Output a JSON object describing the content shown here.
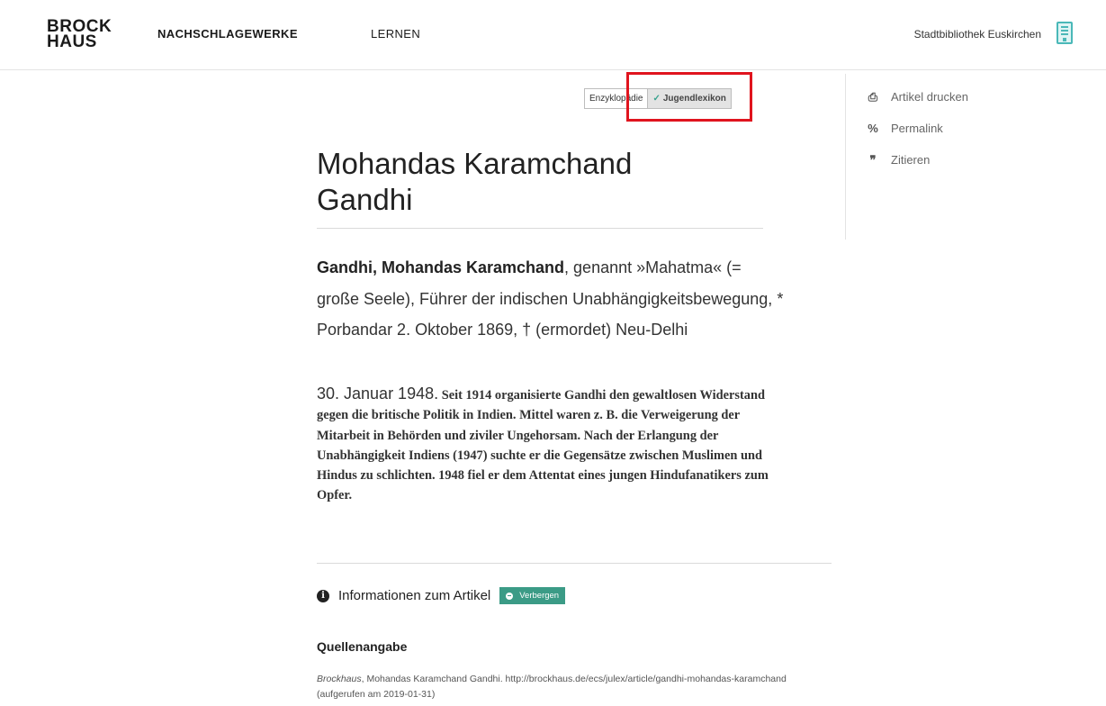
{
  "header": {
    "logo_line1": "BROCK",
    "logo_line2": "HAUS",
    "nav": [
      "NACHSCHLAGEWERKE",
      "LERNEN"
    ],
    "library": "Stadtbibliothek Euskirchen"
  },
  "toggle": {
    "option1": "Enzyklopädie",
    "option2": "Jugendlexikon",
    "active": "Jugendlexikon"
  },
  "sidebar": {
    "items": [
      {
        "label": "Artikel drucken",
        "icon": "printer-icon"
      },
      {
        "label": "Permalink",
        "icon": "link-icon"
      },
      {
        "label": "Zitieren",
        "icon": "quote-icon"
      }
    ]
  },
  "article": {
    "title": "Mohandas Karamchand Gandhi",
    "lead_bold": "Gandhi, Mohandas Karamchand",
    "lead_rest": ", genannt »Mahatma« (= große Seele), Führer der indischen Unabhängigkeitsbewegung, * Porbandar 2. Oktober 1869, † (ermordet) Neu-Delhi",
    "lead_date": "30. Januar 1948.",
    "body": "Seit 1914 organisierte Gandhi den gewaltlosen Widerstand gegen die britische Politik in Indien. Mittel waren z. B. die Verweigerung der Mitarbeit in Behörden und ziviler Ungehorsam. Nach der Erlangung der Unabhängigkeit Indiens (1947) suchte er die Gegensätze zwischen Muslimen und Hindus zu schlichten. 1948 fiel er dem Attentat eines jungen Hindufanatikers zum Opfer."
  },
  "info": {
    "label": "Informationen zum Artikel",
    "button": "Verbergen"
  },
  "sources": {
    "title": "Quellenangabe",
    "prefix": "Brockhaus",
    "text": ", Mohandas Karamchand Gandhi. http://brockhaus.de/ecs/julex/article/gandhi-mohandas-karamchand (aufgerufen am 2019-01-31)"
  },
  "colors": {
    "accent": "#3b9b86",
    "highlight": "#e0141e"
  }
}
